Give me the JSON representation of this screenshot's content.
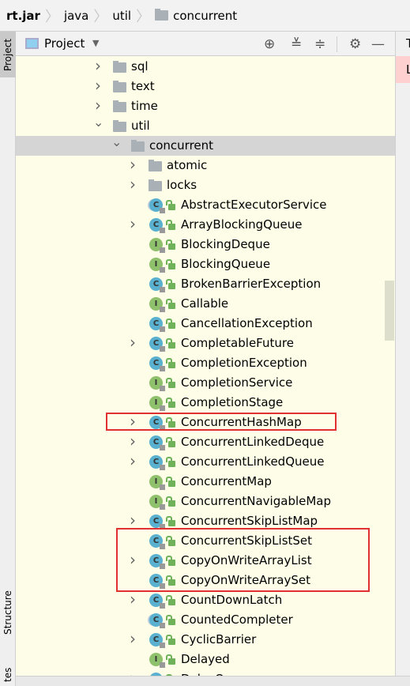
{
  "breadcrumb": [
    "rt.jar",
    "java",
    "util",
    "concurrent"
  ],
  "side_tabs": {
    "project": "Project",
    "structure": "Structure",
    "bottom": "tes"
  },
  "panel": {
    "title": "Project",
    "icons": [
      "locate-icon",
      "expand-all-icon",
      "collapse-all-icon",
      "gear-icon",
      "minimize-icon"
    ]
  },
  "right_fragments": {
    "tab": "T",
    "line": "L"
  },
  "colors": {
    "highlight_box": "#e03030",
    "tree_bg": "#fefee8",
    "class_icon": "#59b0cf",
    "interface_icon": "#8fc06b"
  },
  "tree": [
    {
      "label": "sql",
      "type": "folder",
      "level": 0,
      "chevron": "right"
    },
    {
      "label": "text",
      "type": "folder",
      "level": 0,
      "chevron": "right"
    },
    {
      "label": "time",
      "type": "folder",
      "level": 0,
      "chevron": "right"
    },
    {
      "label": "util",
      "type": "folder",
      "level": 0,
      "chevron": "down"
    },
    {
      "label": "concurrent",
      "type": "folder",
      "level": 1,
      "chevron": "down",
      "selected": true
    },
    {
      "label": "atomic",
      "type": "folder",
      "level": 2,
      "chevron": "right"
    },
    {
      "label": "locks",
      "type": "folder",
      "level": 2,
      "chevron": "right"
    },
    {
      "label": "AbstractExecutorService",
      "type": "abstract",
      "level": 2
    },
    {
      "label": "ArrayBlockingQueue",
      "type": "class",
      "level": 2,
      "chevron": "right"
    },
    {
      "label": "BlockingDeque",
      "type": "interface",
      "level": 2
    },
    {
      "label": "BlockingQueue",
      "type": "interface",
      "level": 2
    },
    {
      "label": "BrokenBarrierException",
      "type": "class",
      "level": 2
    },
    {
      "label": "Callable",
      "type": "interface",
      "level": 2
    },
    {
      "label": "CancellationException",
      "type": "class",
      "level": 2
    },
    {
      "label": "CompletableFuture",
      "type": "class",
      "level": 2,
      "chevron": "right"
    },
    {
      "label": "CompletionException",
      "type": "class",
      "level": 2
    },
    {
      "label": "CompletionService",
      "type": "interface",
      "level": 2
    },
    {
      "label": "CompletionStage",
      "type": "interface",
      "level": 2
    },
    {
      "label": "ConcurrentHashMap",
      "type": "class",
      "level": 2,
      "chevron": "right"
    },
    {
      "label": "ConcurrentLinkedDeque",
      "type": "class",
      "level": 2,
      "chevron": "right"
    },
    {
      "label": "ConcurrentLinkedQueue",
      "type": "class",
      "level": 2,
      "chevron": "right"
    },
    {
      "label": "ConcurrentMap",
      "type": "interface",
      "level": 2
    },
    {
      "label": "ConcurrentNavigableMap",
      "type": "interface",
      "level": 2
    },
    {
      "label": "ConcurrentSkipListMap",
      "type": "class",
      "level": 2,
      "chevron": "right"
    },
    {
      "label": "ConcurrentSkipListSet",
      "type": "class",
      "level": 2
    },
    {
      "label": "CopyOnWriteArrayList",
      "type": "class",
      "level": 2,
      "chevron": "right"
    },
    {
      "label": "CopyOnWriteArraySet",
      "type": "class",
      "level": 2
    },
    {
      "label": "CountDownLatch",
      "type": "class",
      "level": 2,
      "chevron": "right"
    },
    {
      "label": "CountedCompleter",
      "type": "abstract",
      "level": 2
    },
    {
      "label": "CyclicBarrier",
      "type": "class",
      "level": 2,
      "chevron": "right"
    },
    {
      "label": "Delayed",
      "type": "interface",
      "level": 2
    },
    {
      "label": "DelayQueue",
      "type": "class",
      "level": 2,
      "chevron": "right"
    }
  ],
  "highlights": [
    [
      "ConcurrentHashMap"
    ],
    [
      "ConcurrentSkipListSet",
      "CopyOnWriteArrayList",
      "CopyOnWriteArraySet"
    ]
  ]
}
